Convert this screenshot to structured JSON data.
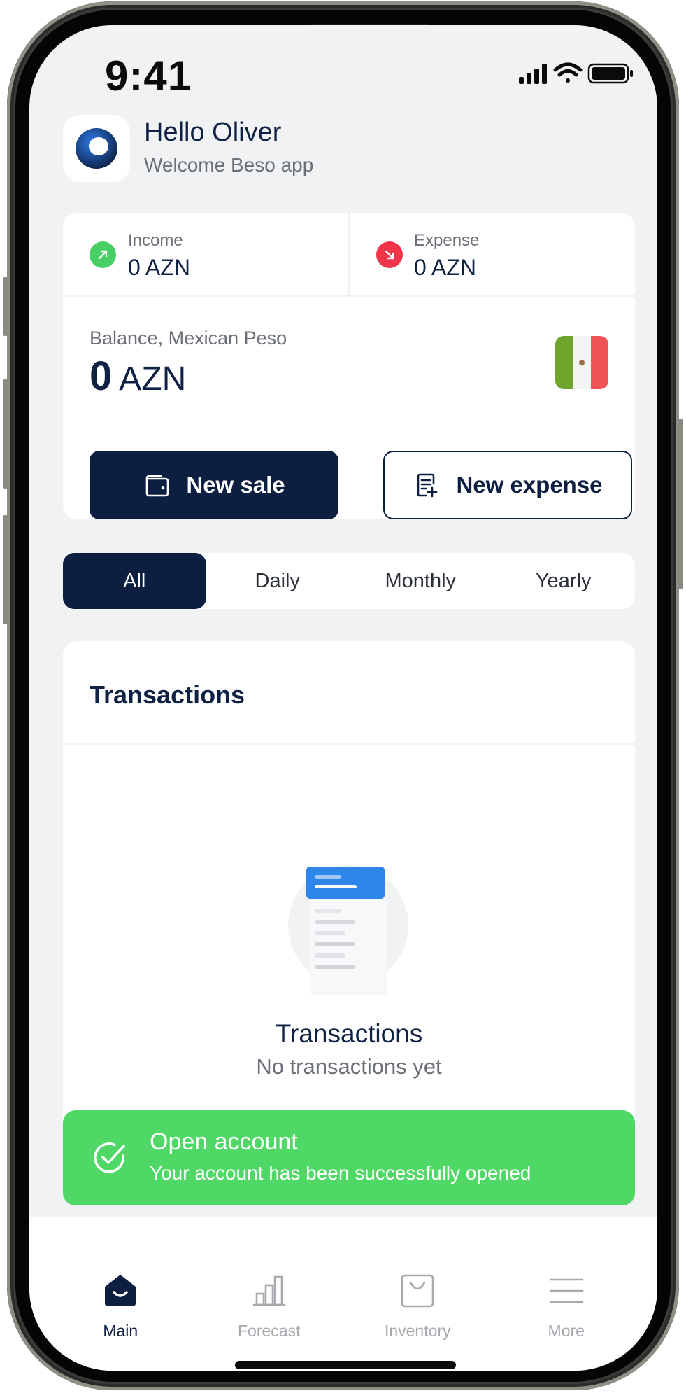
{
  "status_bar": {
    "time": "9:41"
  },
  "header": {
    "greeting": "Hello Oliver",
    "subtitle": "Welcome Beso app"
  },
  "summary": {
    "income": {
      "label": "Income",
      "value": "0 AZN",
      "color": "#47cf63"
    },
    "expense": {
      "label": "Expense",
      "value": "0 AZN",
      "color": "#f2344a"
    },
    "balance": {
      "label": "Balance, Mexican Peso",
      "amount": "0",
      "currency": "AZN"
    },
    "actions": {
      "new_sale": "New sale",
      "new_expense": "New expense"
    }
  },
  "period_tabs": [
    {
      "label": "All",
      "active": true
    },
    {
      "label": "Daily",
      "active": false
    },
    {
      "label": "Monthly",
      "active": false
    },
    {
      "label": "Yearly",
      "active": false
    }
  ],
  "transactions": {
    "title": "Transactions",
    "empty_title": "Transactions",
    "empty_message": "No transactions yet"
  },
  "toast": {
    "title": "Open account",
    "message": "Your account has been successfully opened",
    "color": "#4fd866"
  },
  "bottom_nav": [
    {
      "label": "Main",
      "icon": "home-icon",
      "active": true
    },
    {
      "label": "Forecast",
      "icon": "bar-chart-icon",
      "active": false
    },
    {
      "label": "Inventory",
      "icon": "shopping-bag-icon",
      "active": false
    },
    {
      "label": "More",
      "icon": "menu-icon",
      "active": false
    }
  ],
  "colors": {
    "primary": "#0c1f40",
    "background": "#f1f2f4"
  }
}
